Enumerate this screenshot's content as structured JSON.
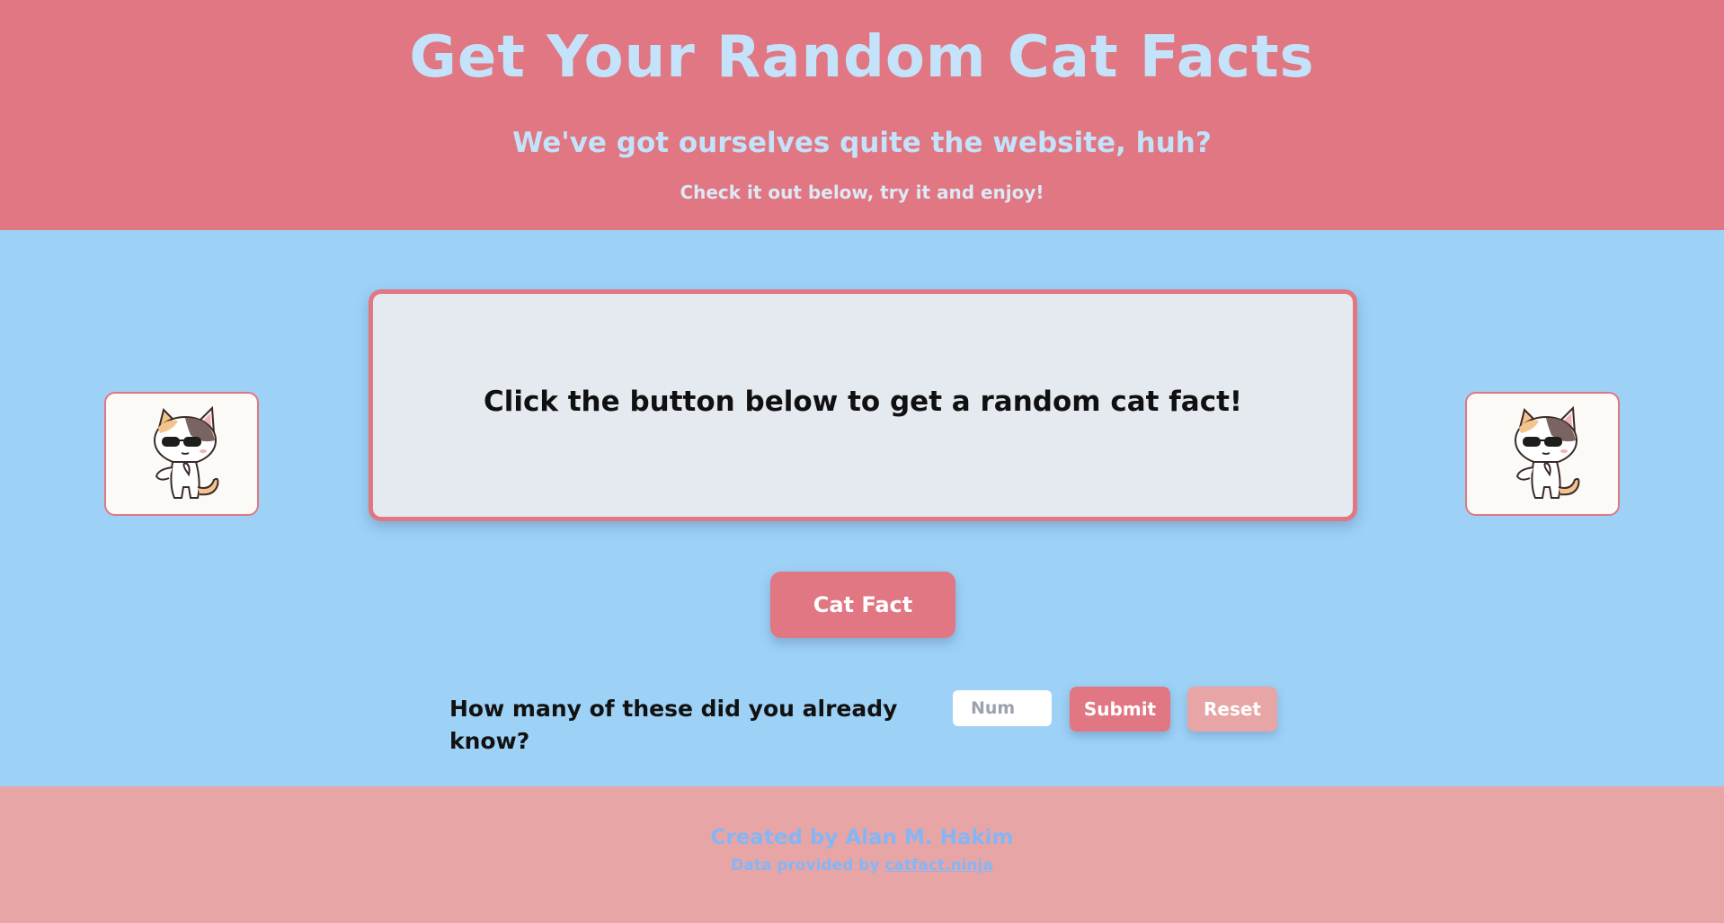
{
  "header": {
    "title": "Get Your Random Cat Facts",
    "subtitle": "We've got ourselves quite the website, huh?",
    "tagline": "Check it out below, try it and enjoy!"
  },
  "main": {
    "fact_text": "Click the button below to get a random cat fact!",
    "cat_fact_button": "Cat Fact",
    "question": "How many of these did you already know?",
    "num_placeholder": "Num",
    "submit_label": "Submit",
    "reset_label": "Reset"
  },
  "footer": {
    "credit": "Created by Alan M. Hakim",
    "data_prefix": "Data provided by",
    "data_link": "catfact.ninja"
  },
  "colors": {
    "header_bg": "#e07782",
    "main_bg": "#9dd1f6",
    "footer_bg": "#e8a5a5",
    "accent": "#e07782",
    "title_text": "#c4e3fa"
  },
  "icons": {
    "left_image": "cat-sunglasses-thumbs-up",
    "right_image": "cat-sunglasses-thumbs-up"
  }
}
